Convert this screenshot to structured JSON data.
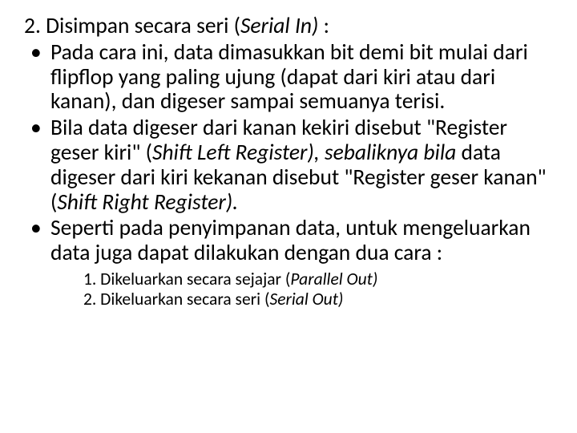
{
  "heading_prefix": "2. Disimpan secara seri (",
  "heading_italic": "Serial In) ",
  "heading_suffix": ":",
  "bullets": {
    "b1": "Pada cara ini, data dimasukkan bit demi bit mulai dari flipflop yang paling ujung (dapat dari kiri atau dari kanan), dan digeser sampai semuanya terisi.",
    "b2_part1": "Bila data digeser dari kanan kekiri disebut \"Register geser kiri\" (",
    "b2_italic1": "Shift Left Register), sebaliknya bila ",
    "b2_part2": "data digeser dari kiri kekanan disebut \"Register geser kanan\" (",
    "b2_italic2": "Shift Right Register).",
    "b3": "Seperti pada penyimpanan data, untuk mengeluarkan data juga dapat dilakukan dengan dua cara :"
  },
  "subs": {
    "s1_prefix": "1. Dikeluarkan secara sejajar (",
    "s1_italic": "Parallel Out)",
    "s2_prefix": "2. Dikeluarkan secara seri (",
    "s2_italic": "Serial Out)"
  }
}
